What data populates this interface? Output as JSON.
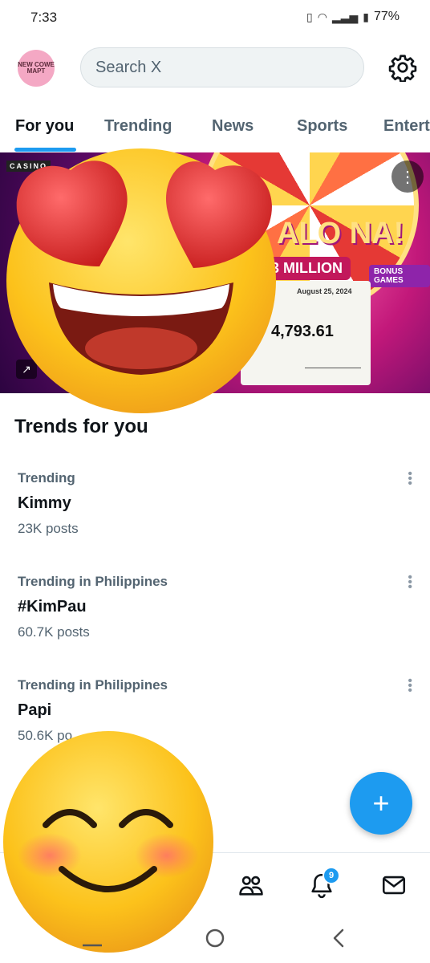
{
  "status_bar": {
    "time": "7:33",
    "battery": "77%"
  },
  "header": {
    "avatar_text": "NEW COWE MAPT",
    "search_placeholder": "Search X"
  },
  "tabs": [
    {
      "label": "For you",
      "active": true
    },
    {
      "label": "Trending",
      "active": false
    },
    {
      "label": "News",
      "active": false
    },
    {
      "label": "Sports",
      "active": false
    },
    {
      "label": "Entert",
      "active": false
    }
  ],
  "banner": {
    "logo": "CASINO",
    "headline": "ALO NA!",
    "million": "03 MILLION",
    "date": "August 25, 2024",
    "amount": "4,793.61",
    "bonus": "BONUS GAMES"
  },
  "trends_title": "Trends for you",
  "trends": [
    {
      "category": "Trending",
      "name": "Kimmy",
      "posts": "23K posts"
    },
    {
      "category": "Trending in Philippines",
      "name": "#KimPau",
      "posts": "60.7K posts"
    },
    {
      "category": "Trending in Philippines",
      "name": "Papi",
      "posts": "50.6K po"
    }
  ],
  "notifications_badge": "9",
  "colors": {
    "accent": "#1d9bf0",
    "text_primary": "#0f1419",
    "text_secondary": "#536471"
  }
}
